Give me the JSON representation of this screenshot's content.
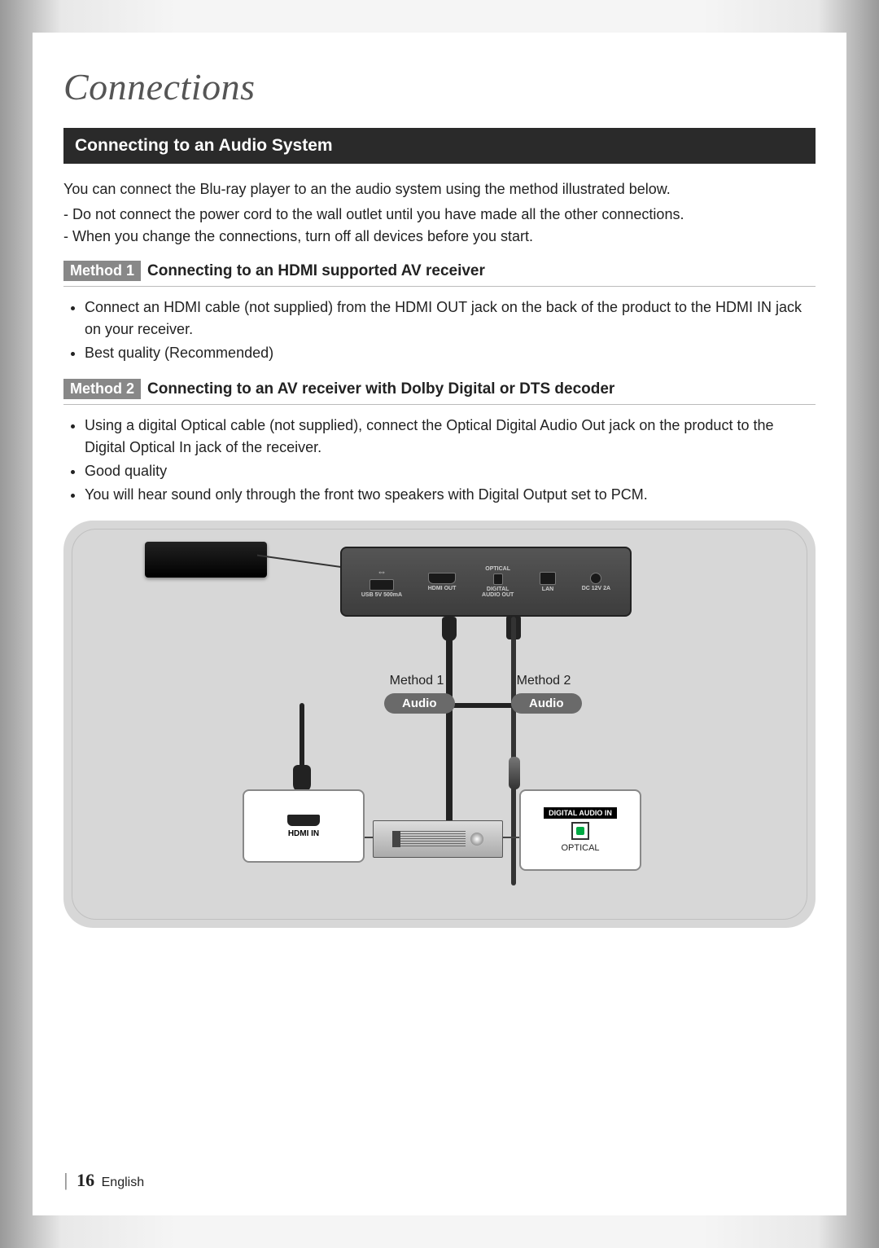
{
  "chapter_title": "Connections",
  "section_title": "Connecting to an Audio System",
  "intro": "You can connect the Blu-ray player to an the audio system using the method illustrated below.",
  "intro_notes": [
    "Do not connect the power cord to the wall outlet until you have made all the other connections.",
    "When you change the connections, turn off all devices before you start."
  ],
  "method1": {
    "badge": "Method 1",
    "title": "Connecting to an HDMI supported AV receiver",
    "bullets": [
      "Connect an HDMI cable (not supplied) from the HDMI OUT jack on the back of the product to the HDMI IN jack on your receiver.",
      "Best quality (Recommended)"
    ]
  },
  "method2": {
    "badge": "Method 2",
    "title": "Connecting to an AV receiver with Dolby Digital or DTS decoder",
    "bullets": [
      "Using a digital Optical cable (not supplied), connect the Optical Digital Audio Out jack on the product to the Digital Optical In jack of the receiver.",
      "Good quality",
      "You will hear sound only through the front two speakers with Digital Output set to PCM."
    ]
  },
  "diagram": {
    "ports": {
      "usb": "USB 5V 500mA",
      "hdmi_out": "HDMI OUT",
      "optical_top": "OPTICAL",
      "digital_audio_out": "DIGITAL\nAUDIO OUT",
      "lan": "LAN",
      "dc": "DC 12V 2A"
    },
    "method1_label": "Method 1",
    "method2_label": "Method 2",
    "audio_label": "Audio",
    "hdmi_in": "HDMI IN",
    "digital_audio_in": "DIGITAL AUDIO IN",
    "optical": "OPTICAL"
  },
  "footer": {
    "page_number": "16",
    "language": "English"
  }
}
